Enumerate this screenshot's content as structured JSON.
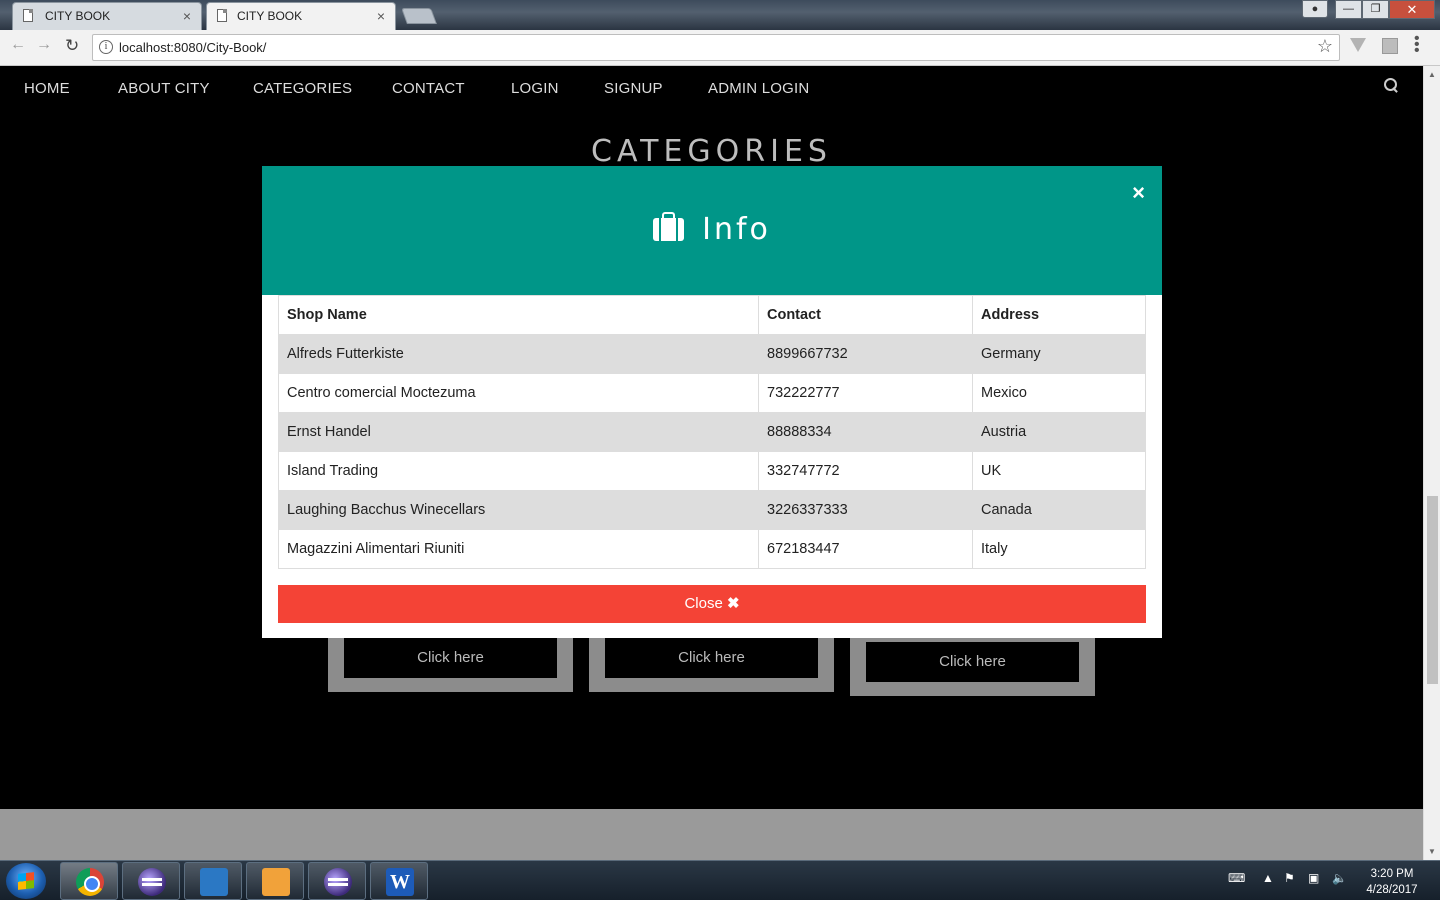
{
  "browser": {
    "tabs": [
      {
        "title": "CITY BOOK",
        "active": false
      },
      {
        "title": "CITY BOOK",
        "active": true
      }
    ],
    "tab_close_glyph": "×",
    "url": "localhost:8080/City-Book/",
    "window_close_glyph": "✕"
  },
  "nav": {
    "items": [
      "HOME",
      "ABOUT CITY",
      "CATEGORIES",
      "CONTACT",
      "LOGIN",
      "SIGNUP",
      "ADMIN LOGIN"
    ]
  },
  "page": {
    "section_title": "CATEGORIES",
    "cards": [
      {
        "button": "Click here"
      },
      {
        "button": "Click here"
      },
      {
        "button": "Click here"
      }
    ]
  },
  "modal": {
    "title": "Info",
    "icon": "briefcase-icon",
    "close_glyph": "×",
    "header_color": "#009688",
    "columns": [
      "Shop Name",
      "Contact",
      "Address"
    ],
    "rows": [
      {
        "shop": "Alfreds Futterkiste",
        "contact": "8899667732",
        "address": "Germany"
      },
      {
        "shop": "Centro comercial Moctezuma",
        "contact": "732222777",
        "address": "Mexico"
      },
      {
        "shop": "Ernst Handel",
        "contact": "88888334",
        "address": "Austria"
      },
      {
        "shop": "Island Trading",
        "contact": "332747772",
        "address": "UK"
      },
      {
        "shop": "Laughing Bacchus Winecellars",
        "contact": "3226337333",
        "address": "Canada"
      },
      {
        "shop": "Magazzini Alimentari Riuniti",
        "contact": "672183447",
        "address": "Italy"
      }
    ],
    "close_button": "Close",
    "close_button_glyph": "✖",
    "close_button_color": "#f44336"
  },
  "taskbar": {
    "apps": [
      "chrome-icon",
      "eclipse-icon",
      "lync-icon",
      "outlook-icon",
      "eclipse-icon",
      "word-icon"
    ],
    "word_glyph": "W",
    "time": "3:20 PM",
    "date": "4/28/2017"
  }
}
